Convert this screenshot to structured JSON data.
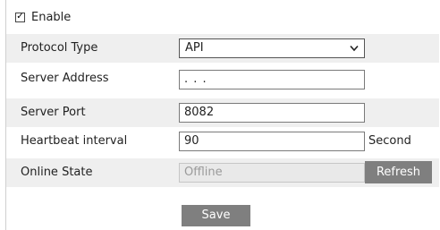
{
  "enable": {
    "label": "Enable",
    "checked": true,
    "check_glyph": "✓"
  },
  "form": {
    "protocol_type": {
      "label": "Protocol Type",
      "value": "API"
    },
    "server_address": {
      "label": "Server Address",
      "value": ".   .   ."
    },
    "server_port": {
      "label": "Server Port",
      "value": "8082"
    },
    "heartbeat_interval": {
      "label": "Heartbeat interval",
      "value": "90",
      "unit": "Second"
    },
    "online_state": {
      "label": "Online State",
      "value": "Offline",
      "refresh_label": "Refresh"
    }
  },
  "save_label": "Save",
  "colors": {
    "row_shade": "#efefef",
    "button_bg": "#7f7f7f",
    "button_text": "#ffffff"
  }
}
